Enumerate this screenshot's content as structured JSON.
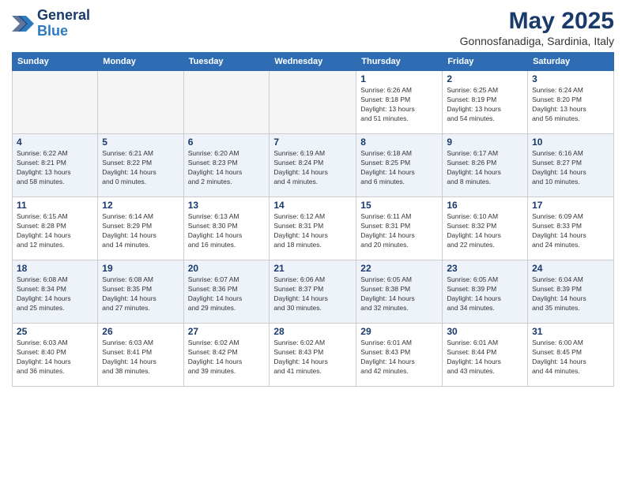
{
  "header": {
    "logo_line1": "General",
    "logo_line2": "Blue",
    "month": "May 2025",
    "location": "Gonnosfanadiga, Sardinia, Italy"
  },
  "weekdays": [
    "Sunday",
    "Monday",
    "Tuesday",
    "Wednesday",
    "Thursday",
    "Friday",
    "Saturday"
  ],
  "weeks": [
    [
      {
        "day": "",
        "info": ""
      },
      {
        "day": "",
        "info": ""
      },
      {
        "day": "",
        "info": ""
      },
      {
        "day": "",
        "info": ""
      },
      {
        "day": "1",
        "info": "Sunrise: 6:26 AM\nSunset: 8:18 PM\nDaylight: 13 hours\nand 51 minutes."
      },
      {
        "day": "2",
        "info": "Sunrise: 6:25 AM\nSunset: 8:19 PM\nDaylight: 13 hours\nand 54 minutes."
      },
      {
        "day": "3",
        "info": "Sunrise: 6:24 AM\nSunset: 8:20 PM\nDaylight: 13 hours\nand 56 minutes."
      }
    ],
    [
      {
        "day": "4",
        "info": "Sunrise: 6:22 AM\nSunset: 8:21 PM\nDaylight: 13 hours\nand 58 minutes."
      },
      {
        "day": "5",
        "info": "Sunrise: 6:21 AM\nSunset: 8:22 PM\nDaylight: 14 hours\nand 0 minutes."
      },
      {
        "day": "6",
        "info": "Sunrise: 6:20 AM\nSunset: 8:23 PM\nDaylight: 14 hours\nand 2 minutes."
      },
      {
        "day": "7",
        "info": "Sunrise: 6:19 AM\nSunset: 8:24 PM\nDaylight: 14 hours\nand 4 minutes."
      },
      {
        "day": "8",
        "info": "Sunrise: 6:18 AM\nSunset: 8:25 PM\nDaylight: 14 hours\nand 6 minutes."
      },
      {
        "day": "9",
        "info": "Sunrise: 6:17 AM\nSunset: 8:26 PM\nDaylight: 14 hours\nand 8 minutes."
      },
      {
        "day": "10",
        "info": "Sunrise: 6:16 AM\nSunset: 8:27 PM\nDaylight: 14 hours\nand 10 minutes."
      }
    ],
    [
      {
        "day": "11",
        "info": "Sunrise: 6:15 AM\nSunset: 8:28 PM\nDaylight: 14 hours\nand 12 minutes."
      },
      {
        "day": "12",
        "info": "Sunrise: 6:14 AM\nSunset: 8:29 PM\nDaylight: 14 hours\nand 14 minutes."
      },
      {
        "day": "13",
        "info": "Sunrise: 6:13 AM\nSunset: 8:30 PM\nDaylight: 14 hours\nand 16 minutes."
      },
      {
        "day": "14",
        "info": "Sunrise: 6:12 AM\nSunset: 8:31 PM\nDaylight: 14 hours\nand 18 minutes."
      },
      {
        "day": "15",
        "info": "Sunrise: 6:11 AM\nSunset: 8:31 PM\nDaylight: 14 hours\nand 20 minutes."
      },
      {
        "day": "16",
        "info": "Sunrise: 6:10 AM\nSunset: 8:32 PM\nDaylight: 14 hours\nand 22 minutes."
      },
      {
        "day": "17",
        "info": "Sunrise: 6:09 AM\nSunset: 8:33 PM\nDaylight: 14 hours\nand 24 minutes."
      }
    ],
    [
      {
        "day": "18",
        "info": "Sunrise: 6:08 AM\nSunset: 8:34 PM\nDaylight: 14 hours\nand 25 minutes."
      },
      {
        "day": "19",
        "info": "Sunrise: 6:08 AM\nSunset: 8:35 PM\nDaylight: 14 hours\nand 27 minutes."
      },
      {
        "day": "20",
        "info": "Sunrise: 6:07 AM\nSunset: 8:36 PM\nDaylight: 14 hours\nand 29 minutes."
      },
      {
        "day": "21",
        "info": "Sunrise: 6:06 AM\nSunset: 8:37 PM\nDaylight: 14 hours\nand 30 minutes."
      },
      {
        "day": "22",
        "info": "Sunrise: 6:05 AM\nSunset: 8:38 PM\nDaylight: 14 hours\nand 32 minutes."
      },
      {
        "day": "23",
        "info": "Sunrise: 6:05 AM\nSunset: 8:39 PM\nDaylight: 14 hours\nand 34 minutes."
      },
      {
        "day": "24",
        "info": "Sunrise: 6:04 AM\nSunset: 8:39 PM\nDaylight: 14 hours\nand 35 minutes."
      }
    ],
    [
      {
        "day": "25",
        "info": "Sunrise: 6:03 AM\nSunset: 8:40 PM\nDaylight: 14 hours\nand 36 minutes."
      },
      {
        "day": "26",
        "info": "Sunrise: 6:03 AM\nSunset: 8:41 PM\nDaylight: 14 hours\nand 38 minutes."
      },
      {
        "day": "27",
        "info": "Sunrise: 6:02 AM\nSunset: 8:42 PM\nDaylight: 14 hours\nand 39 minutes."
      },
      {
        "day": "28",
        "info": "Sunrise: 6:02 AM\nSunset: 8:43 PM\nDaylight: 14 hours\nand 41 minutes."
      },
      {
        "day": "29",
        "info": "Sunrise: 6:01 AM\nSunset: 8:43 PM\nDaylight: 14 hours\nand 42 minutes."
      },
      {
        "day": "30",
        "info": "Sunrise: 6:01 AM\nSunset: 8:44 PM\nDaylight: 14 hours\nand 43 minutes."
      },
      {
        "day": "31",
        "info": "Sunrise: 6:00 AM\nSunset: 8:45 PM\nDaylight: 14 hours\nand 44 minutes."
      }
    ]
  ]
}
